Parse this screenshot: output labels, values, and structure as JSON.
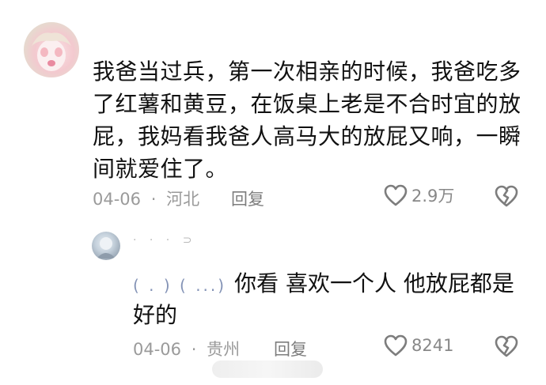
{
  "comment": {
    "text": "我爸当过兵，第一次相亲的时候，我爸吃多了红薯和黄豆，在饭桌上老是不合时宜的放屁，我妈看我爸人高马大的放屁又响，一瞬间就爱住了。",
    "date": "04-06",
    "separator": "·",
    "location": "河北",
    "reply_label": "回复",
    "like_count": "2.9万"
  },
  "reply": {
    "username": "· ·  ·  ⊃",
    "quoted_name": "( . ) ( ...)",
    "text": "你看 喜欢一个人 他放屁都是好的",
    "date": "04-06",
    "separator": "·",
    "location": "贵州",
    "reply_label": "回复",
    "like_count": "8241"
  },
  "icons": {
    "like": "heart-outline-icon",
    "dislike": "broken-heart-icon"
  },
  "colors": {
    "text": "#111111",
    "meta": "#9a9a9a",
    "icon": "#7d7d7d"
  }
}
